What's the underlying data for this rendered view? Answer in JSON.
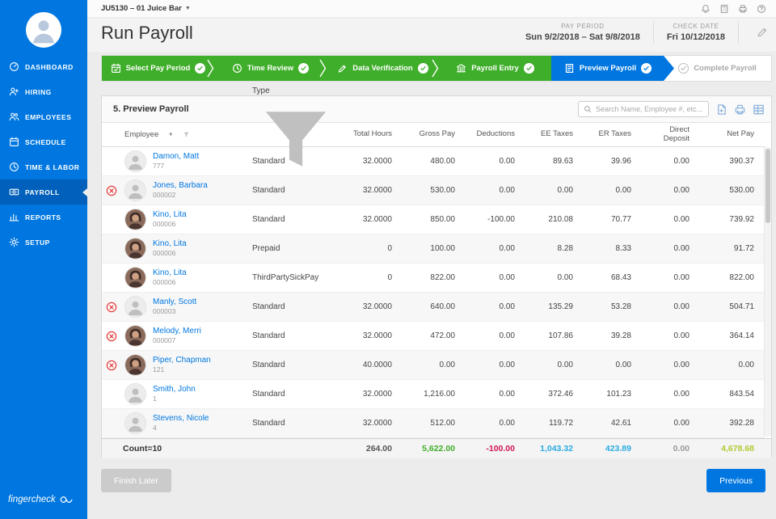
{
  "colors": {
    "brand_blue": "#0077e0",
    "sidebar_active": "#0060bb",
    "step_done_green": "#3fae2a",
    "error_red": "#e23b3b",
    "total_gross_green": "#3fae2a",
    "total_deduction_pink": "#d4145a",
    "total_tax_blue": "#29abe2",
    "total_net_lime": "#b4c832"
  },
  "topbar": {
    "company": "JU5130 – 01 Juice Bar",
    "icons": [
      "notifications-icon",
      "calculator-icon",
      "print-icon",
      "help-icon"
    ]
  },
  "header": {
    "title": "Run Payroll",
    "pay_period_label": "PAY PERIOD",
    "pay_period_value": "Sun 9/2/2018 – Sat 9/8/2018",
    "check_date_label": "CHECK DATE",
    "check_date_value": "Fri 10/12/2018"
  },
  "sidebar": {
    "logo": "fingercheck",
    "items": [
      {
        "key": "dashboard",
        "icon": "dashboard-icon",
        "label": "DASHBOARD",
        "active": false
      },
      {
        "key": "hiring",
        "icon": "hiring-icon",
        "label": "HIRING",
        "active": false
      },
      {
        "key": "employees",
        "icon": "employees-icon",
        "label": "EMPLOYEES",
        "active": false
      },
      {
        "key": "schedule",
        "icon": "schedule-icon",
        "label": "SCHEDULE",
        "active": false
      },
      {
        "key": "time-labor",
        "icon": "clock-icon",
        "label": "TIME & LABOR",
        "active": false
      },
      {
        "key": "payroll",
        "icon": "payroll-icon",
        "label": "PAYROLL",
        "active": true
      },
      {
        "key": "reports",
        "icon": "reports-icon",
        "label": "REPORTS",
        "active": false
      },
      {
        "key": "setup",
        "icon": "gear-icon",
        "label": "SETUP",
        "active": false
      }
    ]
  },
  "stepper": {
    "steps": [
      {
        "label": "Select Pay Period",
        "icon": "calendar-icon",
        "state": "done"
      },
      {
        "label": "Time Review",
        "icon": "clock-icon",
        "state": "done"
      },
      {
        "label": "Data Verification",
        "icon": "pencil-doc-icon",
        "state": "done"
      },
      {
        "label": "Payroll Entry",
        "icon": "bank-icon",
        "state": "done"
      },
      {
        "label": "Preview Payroll",
        "icon": "preview-icon",
        "state": "active"
      },
      {
        "label": "Complete Payroll",
        "icon": "",
        "state": "pending"
      }
    ]
  },
  "panel": {
    "title": "5. Preview Payroll",
    "search_placeholder": "Search Name, Employee #, etc...",
    "toolbar_icons": [
      "export-icon",
      "print-icon",
      "grid-icon"
    ],
    "columns": [
      {
        "key": "employee",
        "label": "Employee",
        "sort": true,
        "filter": true
      },
      {
        "key": "type",
        "label": "Type",
        "sort": false,
        "filter": true
      },
      {
        "key": "hours",
        "label": "Total Hours"
      },
      {
        "key": "gross",
        "label": "Gross Pay"
      },
      {
        "key": "deductions",
        "label": "Deductions"
      },
      {
        "key": "ee",
        "label": "EE Taxes"
      },
      {
        "key": "er",
        "label": "ER Taxes"
      },
      {
        "key": "dd",
        "label": "Direct Deposit"
      },
      {
        "key": "net",
        "label": "Net Pay"
      }
    ],
    "rows": [
      {
        "name": "Damon, Matt",
        "id": "777",
        "type": "Standard",
        "hours": "32.0000",
        "gross": "480.00",
        "deductions": "0.00",
        "ee": "89.63",
        "er": "39.96",
        "dd": "0.00",
        "net": "390.37",
        "error": false,
        "photo": false
      },
      {
        "name": "Jones, Barbara",
        "id": "000002",
        "type": "Standard",
        "hours": "32.0000",
        "gross": "530.00",
        "deductions": "0.00",
        "ee": "0.00",
        "er": "0.00",
        "dd": "0.00",
        "net": "530.00",
        "error": true,
        "photo": false
      },
      {
        "name": "Kino, Lita",
        "id": "000006",
        "type": "Standard",
        "hours": "32.0000",
        "gross": "850.00",
        "deductions": "-100.00",
        "ee": "210.08",
        "er": "70.77",
        "dd": "0.00",
        "net": "739.92",
        "error": false,
        "photo": true
      },
      {
        "name": "Kino, Lita",
        "id": "000006",
        "type": "Prepaid",
        "hours": "0",
        "gross": "100.00",
        "deductions": "0.00",
        "ee": "8.28",
        "er": "8.33",
        "dd": "0.00",
        "net": "91.72",
        "error": false,
        "photo": true
      },
      {
        "name": "Kino, Lita",
        "id": "000006",
        "type": "ThirdPartySickPay",
        "hours": "0",
        "gross": "822.00",
        "deductions": "0.00",
        "ee": "0.00",
        "er": "68.43",
        "dd": "0.00",
        "net": "822.00",
        "error": false,
        "photo": true
      },
      {
        "name": "Manly, Scott",
        "id": "000003",
        "type": "Standard",
        "hours": "32.0000",
        "gross": "640.00",
        "deductions": "0.00",
        "ee": "135.29",
        "er": "53.28",
        "dd": "0.00",
        "net": "504.71",
        "error": true,
        "photo": false
      },
      {
        "name": "Melody, Merri",
        "id": "000007",
        "type": "Standard",
        "hours": "32.0000",
        "gross": "472.00",
        "deductions": "0.00",
        "ee": "107.86",
        "er": "39.28",
        "dd": "0.00",
        "net": "364.14",
        "error": true,
        "photo": true
      },
      {
        "name": "Piper, Chapman",
        "id": "121",
        "type": "Standard",
        "hours": "40.0000",
        "gross": "0.00",
        "deductions": "0.00",
        "ee": "0.00",
        "er": "0.00",
        "dd": "0.00",
        "net": "0.00",
        "error": true,
        "photo": true
      },
      {
        "name": "Smith, John",
        "id": "1",
        "type": "Standard",
        "hours": "32.0000",
        "gross": "1,216.00",
        "deductions": "0.00",
        "ee": "372.46",
        "er": "101.23",
        "dd": "0.00",
        "net": "843.54",
        "error": false,
        "photo": false
      },
      {
        "name": "Stevens, Nicole",
        "id": "4",
        "type": "Standard",
        "hours": "32.0000",
        "gross": "512.00",
        "deductions": "0.00",
        "ee": "119.72",
        "er": "42.61",
        "dd": "0.00",
        "net": "392.28",
        "error": false,
        "photo": false
      }
    ],
    "totals": {
      "count_label": "Count=10",
      "hours": "264.00",
      "gross": "5,622.00",
      "deductions": "-100.00",
      "ee": "1,043.32",
      "er": "423.89",
      "dd": "0.00",
      "net": "4,678.68"
    }
  },
  "footer": {
    "finish_later": "Finish Later",
    "previous": "Previous"
  }
}
